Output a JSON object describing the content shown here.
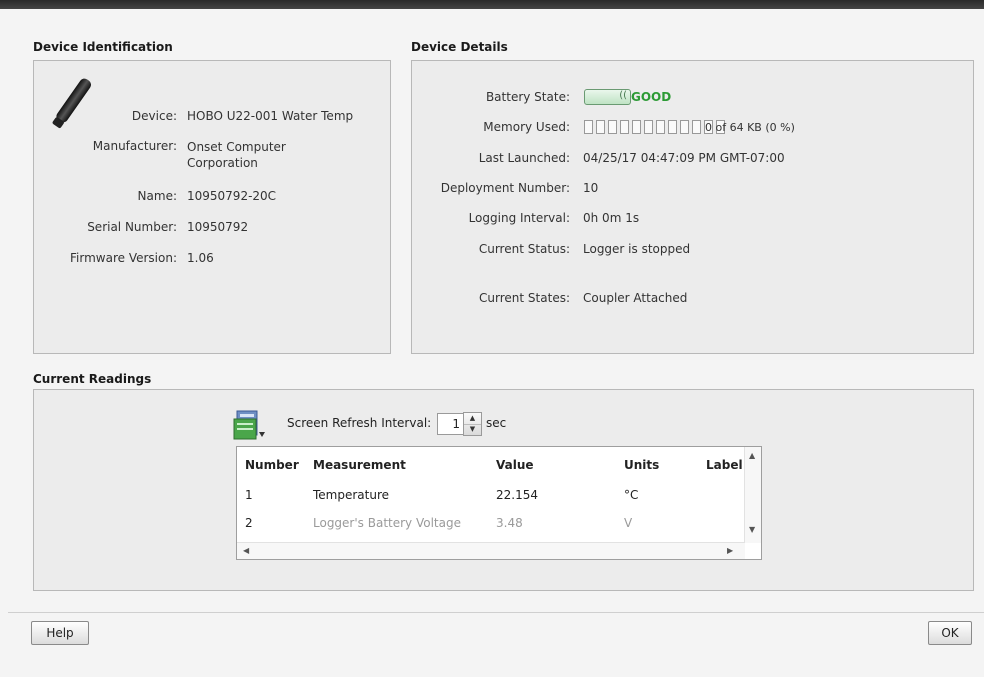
{
  "device_identification": {
    "title": "Device Identification",
    "rows": [
      {
        "label": "Device:",
        "value": "HOBO U22-001 Water Temp"
      },
      {
        "label": "Manufacturer:",
        "value": "Onset Computer Corporation"
      },
      {
        "label": "Name:",
        "value": "10950792-20C"
      },
      {
        "label": "Serial Number:",
        "value": "10950792"
      },
      {
        "label": "Firmware Version:",
        "value": "1.06"
      }
    ]
  },
  "device_details": {
    "title": "Device Details",
    "battery_label": "Battery State:",
    "battery_value": "GOOD",
    "memory_label": "Memory Used:",
    "memory_value": "0 of 64 KB (0 %)",
    "memory_fraction": 0,
    "rows": [
      {
        "label": "Last Launched:",
        "value": "04/25/17 04:47:09 PM GMT-07:00"
      },
      {
        "label": "Deployment Number:",
        "value": "10"
      },
      {
        "label": "Logging Interval:",
        "value": "0h 0m 1s"
      },
      {
        "label": "Current Status:",
        "value": "Logger is stopped"
      },
      {
        "label": "Current States:",
        "value": "Coupler Attached"
      }
    ],
    "colors": {
      "battery_good": "#2c9a35"
    }
  },
  "current_readings": {
    "title": "Current Readings",
    "refresh_label": "Screen Refresh Interval:",
    "refresh_value": "1",
    "refresh_unit": "sec",
    "columns": [
      "Number",
      "Measurement",
      "Value",
      "Units",
      "Label"
    ],
    "rows": [
      {
        "number": "1",
        "measurement": "Temperature",
        "value": "22.154",
        "units": "°C",
        "label": ""
      },
      {
        "number": "2",
        "measurement": "Logger's Battery Voltage",
        "value": "3.48",
        "units": "V",
        "label": ""
      }
    ]
  },
  "footer": {
    "help_label": "Help",
    "ok_label": "OK"
  }
}
